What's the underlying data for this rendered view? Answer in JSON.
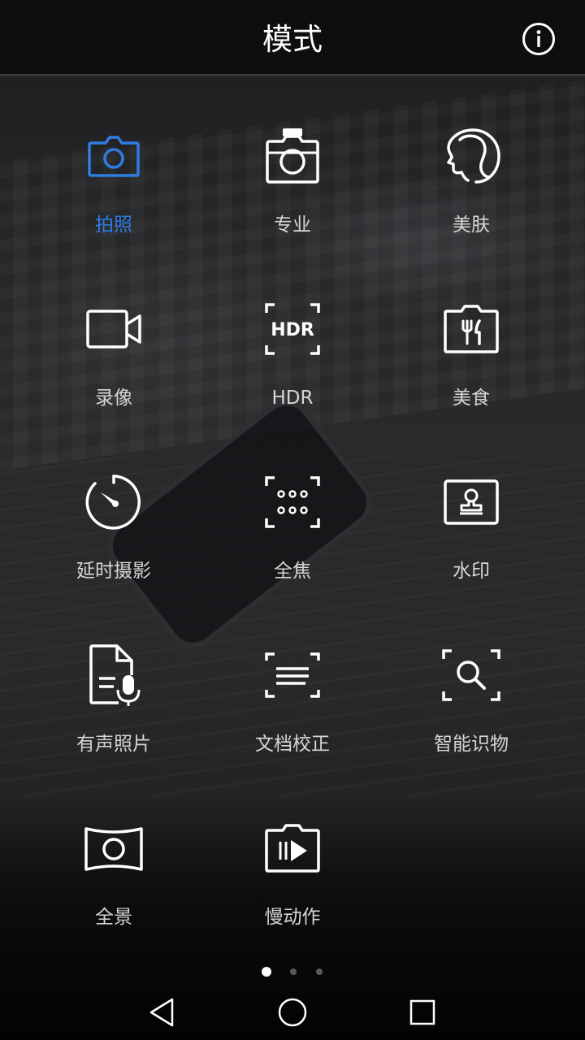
{
  "header": {
    "title": "模式"
  },
  "modes": [
    {
      "label": "拍照",
      "icon": "camera-icon",
      "active": true
    },
    {
      "label": "专业",
      "icon": "pro-camera-icon"
    },
    {
      "label": "美肤",
      "icon": "beauty-face-icon"
    },
    {
      "label": "录像",
      "icon": "video-icon"
    },
    {
      "label": "HDR",
      "icon": "hdr-icon",
      "icon_text": "HDR"
    },
    {
      "label": "美食",
      "icon": "food-icon"
    },
    {
      "label": "延时摄影",
      "icon": "timelapse-icon"
    },
    {
      "label": "全焦",
      "icon": "all-focus-icon"
    },
    {
      "label": "水印",
      "icon": "watermark-icon"
    },
    {
      "label": "有声照片",
      "icon": "audio-photo-icon"
    },
    {
      "label": "文档校正",
      "icon": "document-correction-icon"
    },
    {
      "label": "智能识物",
      "icon": "smart-recognition-icon"
    },
    {
      "label": "全景",
      "icon": "panorama-icon"
    },
    {
      "label": "慢动作",
      "icon": "slow-motion-icon"
    }
  ],
  "pagination": {
    "pages": 3,
    "current": 1
  },
  "colors": {
    "accent": "#2e7ce4",
    "text": "#d6d6d6",
    "icon": "#ffffff"
  }
}
